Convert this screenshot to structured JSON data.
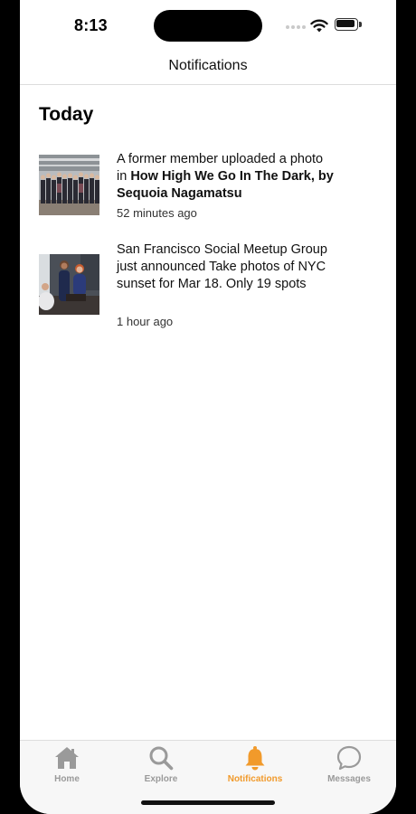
{
  "status_bar": {
    "time": "8:13"
  },
  "nav": {
    "title": "Notifications"
  },
  "section": {
    "title": "Today"
  },
  "notifications": [
    {
      "text_plain": "A former member uploaded a photo in ",
      "text_bold": "How High We Go In The Dark, by Sequoia Nagamatsu",
      "time": "52 minutes ago",
      "thumbnail_icon": "group-photo"
    },
    {
      "text_plain": "San Francisco Social Meetup Group just announced Take photos of NYC sunset for Mar 18. Only 19 spots",
      "time": "1 hour ago",
      "thumbnail_icon": "people-photo"
    }
  ],
  "tabs": [
    {
      "label": "Home",
      "icon": "home-icon",
      "active": false
    },
    {
      "label": "Explore",
      "icon": "search-icon",
      "active": false
    },
    {
      "label": "Notifications",
      "icon": "bell-icon",
      "active": true
    },
    {
      "label": "Messages",
      "icon": "chat-bubble-icon",
      "active": false
    }
  ],
  "colors": {
    "accent": "#f19a2b",
    "inactive_tab": "#9a9a9a"
  }
}
